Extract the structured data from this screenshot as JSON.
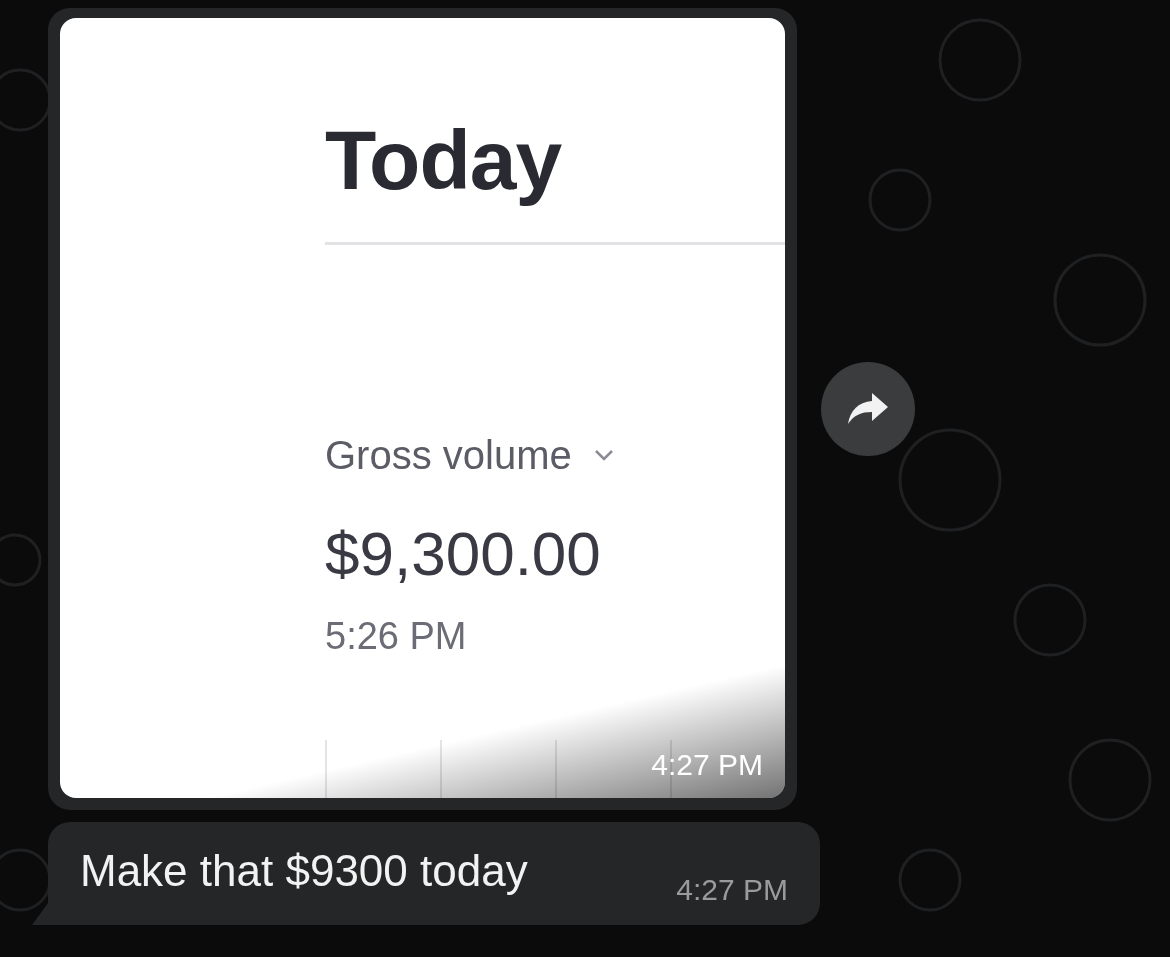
{
  "messages": [
    {
      "kind": "image",
      "screenshot": {
        "title": "Today",
        "metric": "Gross volume",
        "value": "$9,300.00",
        "time": "5:26 PM"
      },
      "time": "4:27 PM"
    },
    {
      "kind": "text",
      "text": "Make that $9300 today",
      "time": "4:27 PM"
    }
  ]
}
